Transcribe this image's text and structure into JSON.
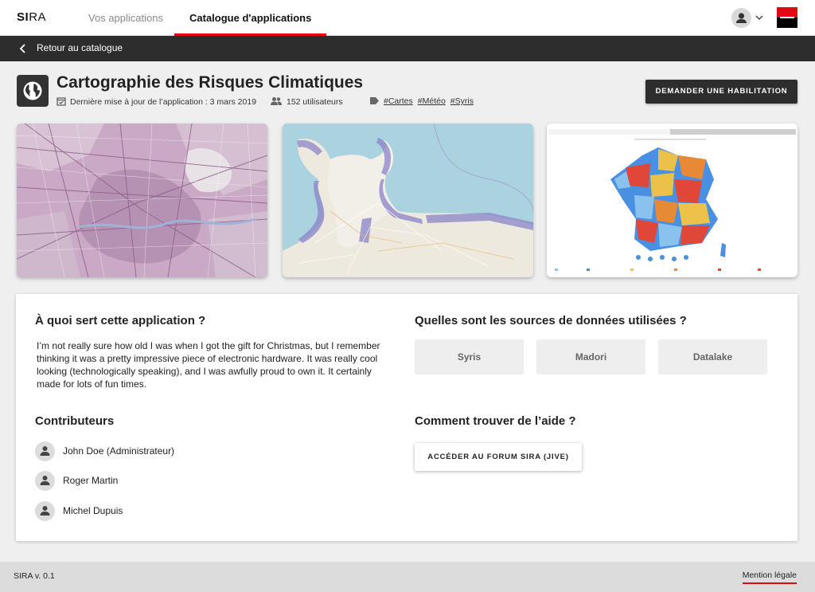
{
  "header": {
    "logo_bold": "SI",
    "logo_light": "RA",
    "tabs": [
      {
        "label": "Vos applications"
      },
      {
        "label": "Catalogue d'applications"
      }
    ]
  },
  "backbar": {
    "label": "Retour au catalogue"
  },
  "app": {
    "title": "Cartographie des Risques Climatiques",
    "updated": "Dernière mise à jour de l’application : 3 mars 2019",
    "users": "152 utilisateurs",
    "tags": [
      "#Cartes",
      "#Météo",
      "#Syris"
    ],
    "cta": "DEMANDER UNE HABILITATION"
  },
  "purpose": {
    "heading": "À quoi sert cette application ?",
    "text": "I’m not really sure how old I was when I got the gift for Christmas, but I remember thinking it was a pretty impressive piece of electronic hardware. It was really cool looking (technologically speaking), and I was awfully proud to own it. It certainly made for lots of fun times."
  },
  "sources": {
    "heading": "Quelles sont les sources de données utilisées ?",
    "items": [
      "Syris",
      "Madori",
      "Datalake"
    ]
  },
  "contributors": {
    "heading": "Contributeurs",
    "items": [
      "John Doe (Administrateur)",
      "Roger Martin",
      "Michel Dupuis"
    ]
  },
  "help": {
    "heading": "Comment trouver de l’aide ?",
    "button": "ACCÉDER AU FORUM SIRA (JIVE)"
  },
  "footer": {
    "version": "SIRA v. 0.1",
    "legal": "Mention légale"
  },
  "colors": {
    "accent": "#e30613",
    "dark": "#2d2d2d"
  }
}
